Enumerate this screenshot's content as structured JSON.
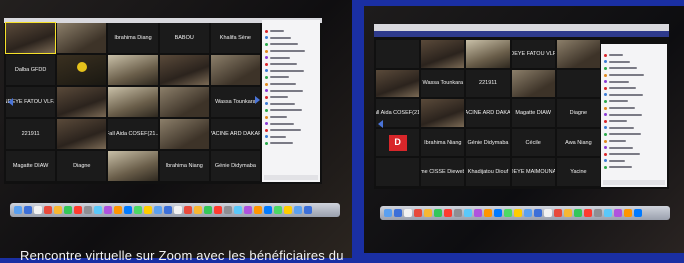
{
  "left_screen": {
    "tiles": [
      {
        "label": "",
        "kind": "face",
        "active": true
      },
      {
        "label": "",
        "kind": "face2"
      },
      {
        "label": "Ibrahima Diang",
        "kind": "text"
      },
      {
        "label": "BABOU",
        "kind": "text"
      },
      {
        "label": "Khalifa Sène",
        "kind": "text"
      },
      {
        "label": "Dalba GFDD",
        "kind": "text"
      },
      {
        "label": "",
        "kind": "yellow"
      },
      {
        "label": "",
        "kind": "face3"
      },
      {
        "label": "",
        "kind": "face"
      },
      {
        "label": "",
        "kind": "face2"
      },
      {
        "label": "NDEYE FATOU VLF...",
        "kind": "text"
      },
      {
        "label": "",
        "kind": "face"
      },
      {
        "label": "",
        "kind": "face3"
      },
      {
        "label": "",
        "kind": "face2"
      },
      {
        "label": "Wassa Tounkara",
        "kind": "text"
      },
      {
        "label": "221911",
        "kind": "text"
      },
      {
        "label": "",
        "kind": "face"
      },
      {
        "label": "Fall Aida COSEF(21...",
        "kind": "text"
      },
      {
        "label": "",
        "kind": "face2"
      },
      {
        "label": "YACINE ARD DAKAR",
        "kind": "text"
      },
      {
        "label": "Magatte DIAW",
        "kind": "text"
      },
      {
        "label": "Diagne",
        "kind": "text"
      },
      {
        "label": "",
        "kind": "face3"
      },
      {
        "label": "Ibrahima Niang",
        "kind": "text"
      },
      {
        "label": "Génie Didymaba",
        "kind": "text"
      }
    ]
  },
  "right_screen": {
    "tiles": [
      {
        "label": "",
        "kind": "blank"
      },
      {
        "label": "",
        "kind": "face"
      },
      {
        "label": "",
        "kind": "face3"
      },
      {
        "label": "NDEYE FATOU VLF...",
        "kind": "text"
      },
      {
        "label": "",
        "kind": "face2"
      },
      {
        "label": "",
        "kind": "face"
      },
      {
        "label": "Wassa Tounkara",
        "kind": "text"
      },
      {
        "label": "221911",
        "kind": "text"
      },
      {
        "label": "",
        "kind": "face2"
      },
      {
        "label": "",
        "kind": "blank"
      },
      {
        "label": "Fall Aida COSEF(21...",
        "kind": "text"
      },
      {
        "label": "",
        "kind": "face"
      },
      {
        "label": "YACINE ARD DAKAR",
        "kind": "text"
      },
      {
        "label": "Magatte DIAW",
        "kind": "text"
      },
      {
        "label": "Diagne",
        "kind": "text"
      },
      {
        "label": "",
        "kind": "red",
        "avatar": "D"
      },
      {
        "label": "Ibrahima Niang",
        "kind": "text"
      },
      {
        "label": "Génie Didymaba",
        "kind": "text"
      },
      {
        "label": "Cécile",
        "kind": "text"
      },
      {
        "label": "Awa Niang",
        "kind": "text"
      },
      {
        "label": "",
        "kind": "blank"
      },
      {
        "label": "Mme CISSE Dieweb...",
        "kind": "text"
      },
      {
        "label": "Khadijatou Diouf",
        "kind": "text"
      },
      {
        "label": "NDEYE MAIMOUNA...",
        "kind": "text"
      },
      {
        "label": "Yacine",
        "kind": "text"
      }
    ]
  },
  "caption": "Rencontre virtuelle sur Zoom avec les bénéficiaires du",
  "colors": {
    "background": "#1a2fa3",
    "highlight": "#f5e12a",
    "avatar_red": "#d8262a"
  },
  "icons": {
    "nav_left": "chevron-left-icon",
    "nav_right": "chevron-right-icon"
  }
}
